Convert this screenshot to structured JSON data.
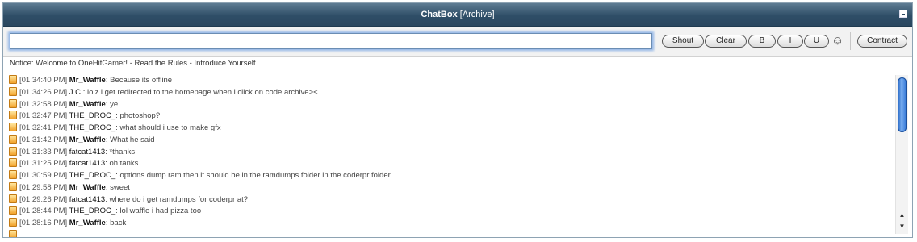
{
  "header": {
    "title": "ChatBox",
    "archive_link": "[Archive]",
    "collapse_icon": "minus-box-icon"
  },
  "toolbar": {
    "shout_input_value": "",
    "buttons": {
      "shout": "Shout",
      "clear": "Clear",
      "bold": "B",
      "italic": "I",
      "underline": "U",
      "contract": "Contract"
    },
    "smiley": "☺"
  },
  "notice": "Notice: Welcome to OneHitGamer! - Read the Rules - Introduce Yourself",
  "messages": [
    {
      "time": "[01:34:40 PM]",
      "user": "Mr_Waffle",
      "bold": true,
      "text": ": Because its offline"
    },
    {
      "time": "[01:34:26 PM]",
      "user": "J.C.",
      "bold": false,
      "text": ": lolz i get redirected to the homepage when i click on code archive><"
    },
    {
      "time": "[01:32:58 PM]",
      "user": "Mr_Waffle",
      "bold": true,
      "text": ": ye"
    },
    {
      "time": "[01:32:47 PM]",
      "user": "THE_DROC_",
      "bold": false,
      "text": ": photoshop?"
    },
    {
      "time": "[01:32:41 PM]",
      "user": "THE_DROC_",
      "bold": false,
      "text": ": what should i use to make gfx"
    },
    {
      "time": "[01:31:42 PM]",
      "user": "Mr_Waffle",
      "bold": true,
      "text": ": What he said"
    },
    {
      "time": "[01:31:33 PM]",
      "user": "fatcat1413",
      "bold": false,
      "text": ": *thanks"
    },
    {
      "time": "[01:31:25 PM]",
      "user": "fatcat1413",
      "bold": false,
      "text": ": oh tanks"
    },
    {
      "time": "[01:30:59 PM]",
      "user": "THE_DROC_",
      "bold": false,
      "text": ": options dump ram then it should be in the ramdumps folder in the coderpr folder"
    },
    {
      "time": "[01:29:58 PM]",
      "user": "Mr_Waffle",
      "bold": true,
      "text": ": sweet"
    },
    {
      "time": "[01:29:26 PM]",
      "user": "fatcat1413",
      "bold": false,
      "text": ": where do i get ramdumps for coderpr at?"
    },
    {
      "time": "[01:28:44 PM]",
      "user": "THE_DROC_",
      "bold": false,
      "text": ": lol waffle i had pizza too"
    },
    {
      "time": "[01:28:16 PM]",
      "user": "Mr_Waffle",
      "bold": true,
      "text": ": back"
    }
  ],
  "scrollbar": {
    "up_arrow": "▲",
    "down_arrow": "▼"
  },
  "colors": {
    "titlebar": "#2f4e67",
    "input_glow": "#8fb4e6",
    "scroll_thumb": "#2e72d4"
  }
}
